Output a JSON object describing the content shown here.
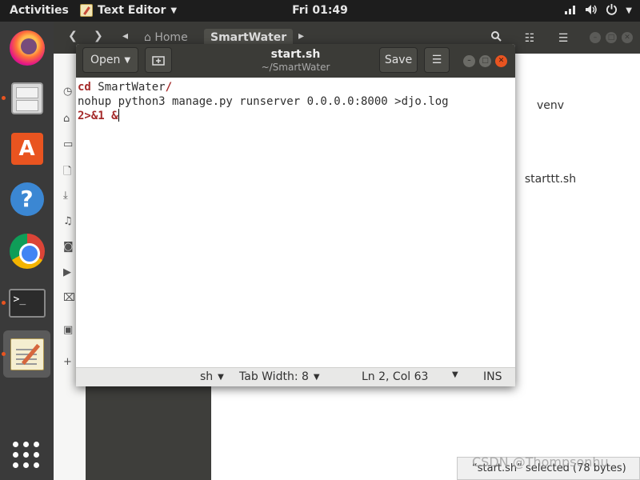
{
  "topbar": {
    "activities": "Activities",
    "app_menu": "Text Editor",
    "clock": "Fri 01:49",
    "tray_icons": [
      "network-icon",
      "volume-icon",
      "power-icon"
    ]
  },
  "dock": {
    "items": [
      {
        "name": "firefox",
        "running": false
      },
      {
        "name": "files",
        "running": true
      },
      {
        "name": "ubuntu-software",
        "running": false
      },
      {
        "name": "help",
        "running": false
      },
      {
        "name": "chrome",
        "running": false
      },
      {
        "name": "terminal",
        "running": true
      },
      {
        "name": "text-editor",
        "running": true,
        "active": true
      }
    ],
    "show_apps_icon": "grid-icon"
  },
  "files_window": {
    "breadcrumb_home": "Home",
    "breadcrumb_current": "SmartWater",
    "items": [
      {
        "name": "venv",
        "type": "folder"
      },
      {
        "name": "starttt.sh",
        "type": "file"
      }
    ],
    "status": "“start.sh” selected (78 bytes)",
    "accent": "#e2642b"
  },
  "gedit": {
    "open_label": "Open",
    "save_label": "Save",
    "title": "start.sh",
    "subtitle": "~/SmartWater",
    "code": {
      "line1_cmd": "cd",
      "line1_arg": " SmartWater",
      "line1_slash": "/",
      "line2a": "nohup python3 manage.py runserver 0.0.0.0:8000 >djo.log",
      "line2b_redirect": "2>&1 &"
    },
    "status": {
      "language": "sh",
      "tab_width": "Tab Width: 8",
      "position": "Ln 2, Col 63",
      "mode": "INS"
    },
    "keyword_color": "#a52a2a"
  },
  "watermark": "CSDN @Thompsonhu"
}
